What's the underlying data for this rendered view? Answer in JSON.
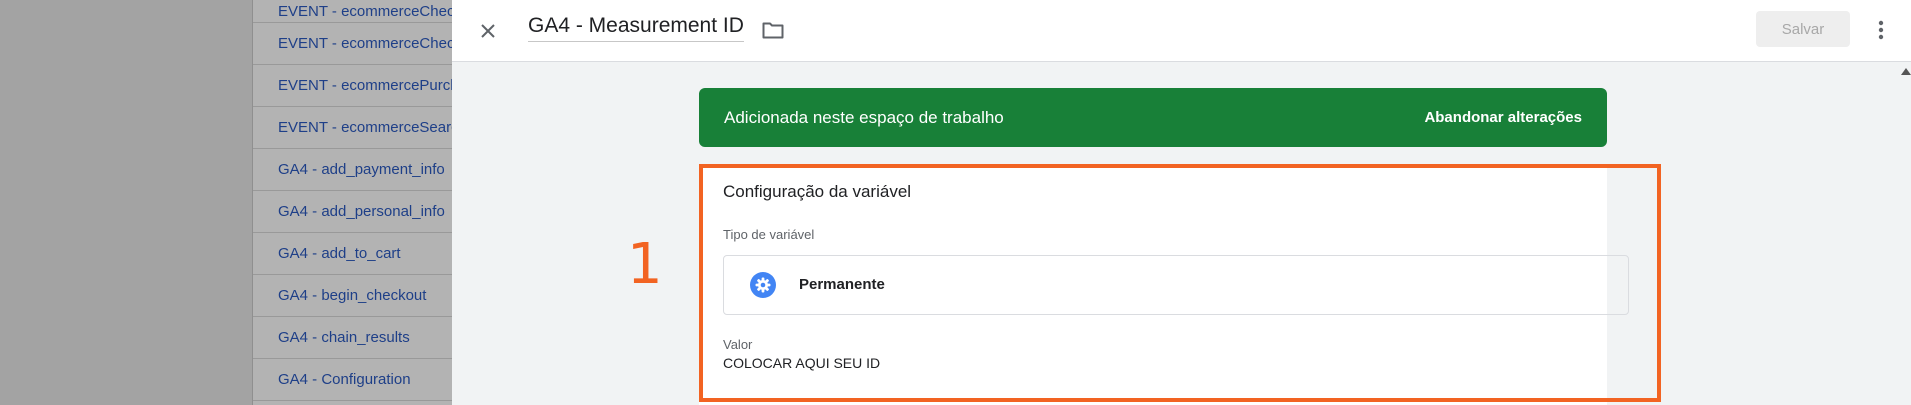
{
  "background_list": {
    "items": [
      "EVENT - ecommerceCheck",
      "EVENT - ecommerceCheck",
      "EVENT - ecommercePurch",
      "EVENT - ecommerceSearc",
      "GA4 - add_payment_info",
      "GA4 - add_personal_info",
      "GA4 - add_to_cart",
      "GA4 - begin_checkout",
      "GA4 - chain_results",
      "GA4 - Configuration"
    ]
  },
  "header": {
    "title": "GA4 - Measurement ID",
    "save_label": "Salvar",
    "close_icon": "close-icon",
    "folder_icon": "folder-icon",
    "more_icon": "more-vert-icon"
  },
  "banner": {
    "text": "Adicionada neste espaço de trabalho",
    "action": "Abandonar alterações",
    "color": "#188038"
  },
  "card": {
    "title": "Configuração da variável",
    "type_label": "Tipo de variável",
    "type_name": "Permanente",
    "type_icon": "gear-icon",
    "value_label": "Valor",
    "value": "COLOCAR AQUI SEU ID"
  },
  "annotation": {
    "number": "1",
    "color": "#f26322"
  }
}
